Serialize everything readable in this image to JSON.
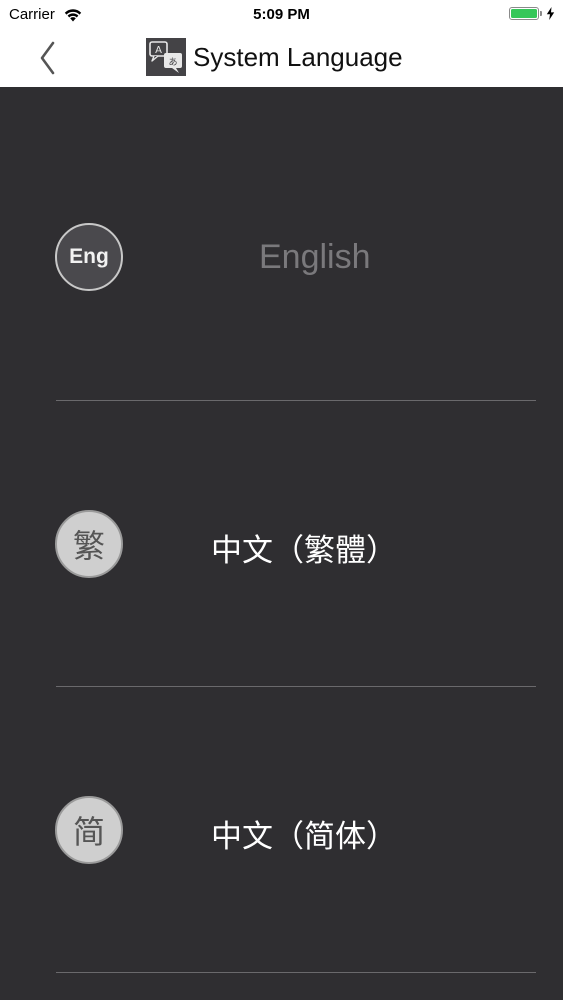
{
  "status_bar": {
    "carrier": "Carrier",
    "time": "5:09 PM",
    "battery_level": 1.0,
    "battery_color": "#35c759"
  },
  "nav": {
    "back_icon": "chevron-left-icon",
    "title_icon": "language-translate-icon",
    "title": "System Language"
  },
  "languages": [
    {
      "badge": "Eng",
      "label": "English",
      "state": "selected-disabled"
    },
    {
      "badge": "繁",
      "label": "中文（繁體）",
      "state": "available"
    },
    {
      "badge": "简",
      "label": "中文（简体）",
      "state": "available"
    }
  ],
  "colors": {
    "background": "#2f2e31",
    "header": "#ffffff",
    "disabled_text": "#7a797c",
    "active_text": "#ffffff"
  }
}
